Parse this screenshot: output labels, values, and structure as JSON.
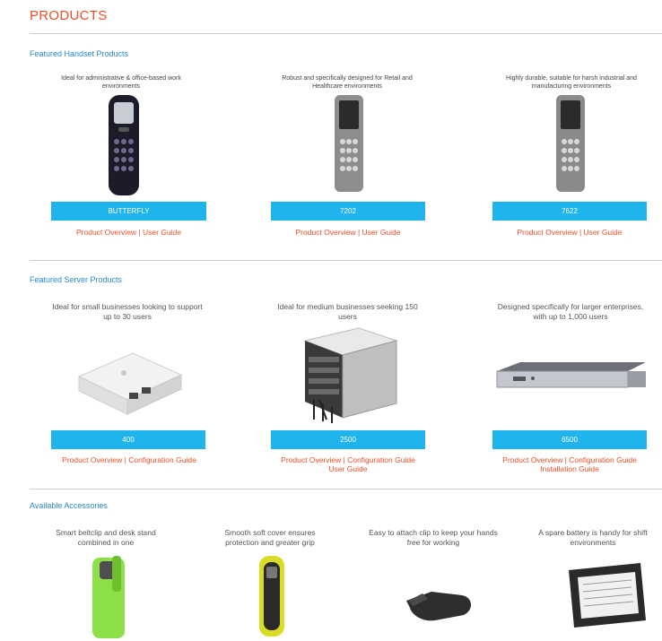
{
  "page_title": "PRODUCTS",
  "handsets": {
    "title": "Featured Handset Products",
    "items": [
      {
        "desc": "Ideal for administrative & office-based work environments",
        "name": "BUTTERFLY",
        "link1": "Product Overview",
        "sep": " | ",
        "link2": "User Guide"
      },
      {
        "desc": "Robust and specifically designed for Retail and Healthcare environments",
        "name": "7202",
        "link1": "Product Overview",
        "sep": " | ",
        "link2": "User Guide"
      },
      {
        "desc": "Highly durable, suitable for harsh industrial and manufacturing environments",
        "name": "7622",
        "link1": "Product Overview",
        "sep": " | ",
        "link2": "User Guide"
      }
    ]
  },
  "servers": {
    "title": "Featured Server Products",
    "items": [
      {
        "desc": "Ideal for small businesses looking to support up to 30 users",
        "name": "400",
        "link1": "Product Overview",
        "sep": " | ",
        "link2": "Configuration Guide",
        "link3": ""
      },
      {
        "desc": "Ideal for medium businesses seeking 150 users",
        "name": "2500",
        "link1": "Product Overview",
        "sep": " | ",
        "link2": "Configuration Guide",
        "link3": "User Guide"
      },
      {
        "desc": "Designed specifically for larger enterprises, with up to 1,000 users",
        "name": "6500",
        "link1": "Product Overview",
        "sep": " | ",
        "link2": "Configuration Guide",
        "link3": "Installation Guide"
      }
    ]
  },
  "accessories": {
    "title": "Available Accessories",
    "items": [
      {
        "desc": "Smart beltclip and desk stand combined in one"
      },
      {
        "desc": "Smooth soft cover ensures protection and greater grip"
      },
      {
        "desc": "Easy to attach clip to keep your hands free for working"
      },
      {
        "desc": "A spare battery is handy for shift environments"
      }
    ]
  },
  "colors": {
    "accent": "#e8502a",
    "bar": "#1fb4ec",
    "section_title": "#2a8ad4"
  }
}
